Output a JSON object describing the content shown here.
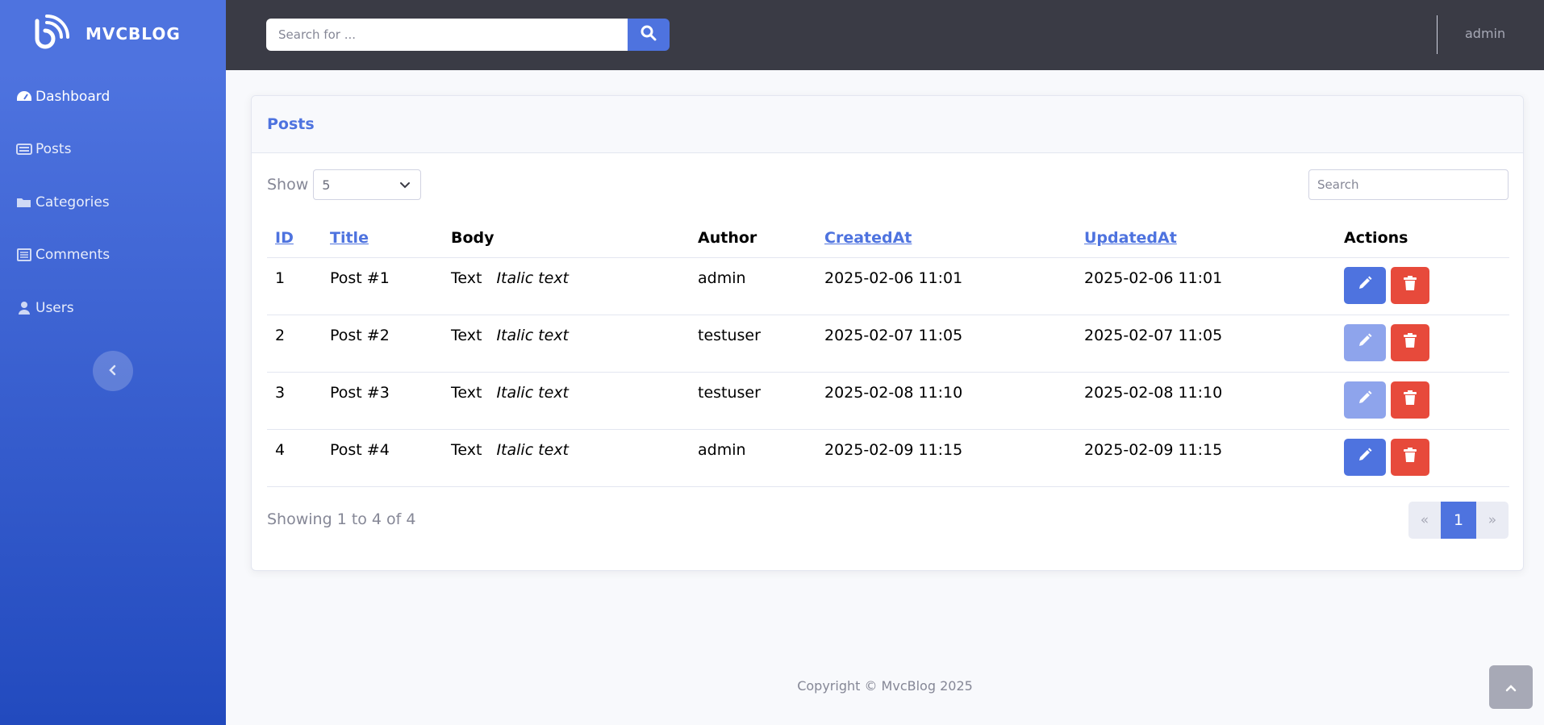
{
  "brand": {
    "name": "MVCBLOG"
  },
  "sidebar": {
    "items": [
      {
        "label": "Dashboard",
        "icon": "dashboard-icon"
      },
      {
        "label": "Posts",
        "icon": "posts-icon"
      },
      {
        "label": "Categories",
        "icon": "folder-icon"
      },
      {
        "label": "Comments",
        "icon": "list-icon"
      },
      {
        "label": "Users",
        "icon": "user-icon"
      }
    ]
  },
  "topbar": {
    "search_placeholder": "Search for ...",
    "user": "admin"
  },
  "card": {
    "title": "Posts",
    "show_label": "Show",
    "page_size": "5",
    "search_placeholder": "Search"
  },
  "table": {
    "headers": [
      "ID",
      "Title",
      "Body",
      "Author",
      "CreatedAt",
      "UpdatedAt",
      "Actions"
    ],
    "rows": [
      {
        "id": "1",
        "title": "Post #1",
        "body_text": "Text",
        "body_italic": "Italic text",
        "author": "admin",
        "created": "2025-02-06 11:01",
        "updated": "2025-02-06 11:01"
      },
      {
        "id": "2",
        "title": "Post #2",
        "body_text": "Text",
        "body_italic": "Italic text",
        "author": "testuser",
        "created": "2025-02-07 11:05",
        "updated": "2025-02-07 11:05"
      },
      {
        "id": "3",
        "title": "Post #3",
        "body_text": "Text",
        "body_italic": "Italic text",
        "author": "testuser",
        "created": "2025-02-08 11:10",
        "updated": "2025-02-08 11:10"
      },
      {
        "id": "4",
        "title": "Post #4",
        "body_text": "Text",
        "body_italic": "Italic text",
        "author": "admin",
        "created": "2025-02-09 11:15",
        "updated": "2025-02-09 11:15"
      }
    ]
  },
  "summary": "Showing 1 to 4 of 4",
  "pagination": {
    "prev": "«",
    "current": "1",
    "next": "»"
  },
  "footer": {
    "copyright": "Copyright © MvcBlog 2025"
  },
  "colors": {
    "primary": "#4e73df",
    "danger": "#e74a3b",
    "topbar": "#3a3b45"
  }
}
